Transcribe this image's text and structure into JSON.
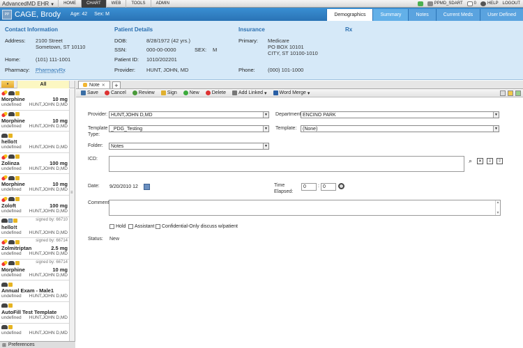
{
  "topbar": {
    "brand": "AdvancedMD EHR",
    "nav": [
      "HOME",
      "CHART",
      "WEB",
      "TOOLS",
      "ADMIN"
    ],
    "active_nav": "CHART",
    "user": "PPMD_SDART",
    "mail_count": "0",
    "help": "HELP",
    "logout": "LOGOUT"
  },
  "patient": {
    "name": "CAGE, Brody",
    "age": "Age: 42",
    "sex": "Sex: M",
    "avatar_text": "PP",
    "tabs": [
      "Demographics",
      "Summary",
      "Notes",
      "Current Meds",
      "User Defined"
    ],
    "active_tab": "Demographics"
  },
  "demographics": {
    "contact": {
      "title": "Contact Information",
      "address_label": "Address:",
      "address_line1": "2100 Street",
      "address_line2": "Sometown, ST 10110",
      "home_label": "Home:",
      "home": "(101) 111-1001",
      "pharmacy_label": "Pharmacy:",
      "pharmacy": "PharmacyRx"
    },
    "details": {
      "title": "Patient Details",
      "dob_label": "DOB:",
      "dob": "8/28/1972 (42 yrs.)",
      "ssn_label": "SSN:",
      "ssn": "000-00-0000",
      "sex_label": "SEX:",
      "sex": "M",
      "pid_label": "Patient ID:",
      "pid": "1010/202201",
      "provider_label": "Provider:",
      "provider": "HUNT, JOHN, MD"
    },
    "insurance": {
      "title": "Insurance",
      "primary_label": "Primary:",
      "primary_line1": "Medicare",
      "primary_line2": "PO BOX 10101",
      "primary_line3": "CITY, ST 10100-1010",
      "phone_label": "Phone:",
      "phone": "(000) 101-1000"
    },
    "rx": {
      "title": "Rx"
    }
  },
  "left_panel": {
    "all_label": "All",
    "items": [
      {
        "title": "Morphine",
        "dose": "10 mg",
        "status": "undefined",
        "provider": "HUNT,JOHN D,MD",
        "signed": ""
      },
      {
        "title": "Morphine",
        "dose": "10 mg",
        "status": "undefined",
        "provider": "HUNT,JOHN D,MD",
        "signed": ""
      },
      {
        "title": "hello!t",
        "dose": "",
        "status": "undefined",
        "provider": "HUNT,JOHN D,MD",
        "signed": ""
      },
      {
        "title": "Zolinza",
        "dose": "100 mg",
        "status": "undefined",
        "provider": "HUNT,JOHN D,MD",
        "signed": ""
      },
      {
        "title": "Morphine",
        "dose": "10 mg",
        "status": "undefined",
        "provider": "HUNT,JOHN D,MD",
        "signed": ""
      },
      {
        "title": "Zoloft",
        "dose": "100 mg",
        "status": "undefined",
        "provider": "HUNT,JOHN D,MD",
        "signed": ""
      },
      {
        "title": "hello!t",
        "dose": "",
        "status": "undefined",
        "provider": "HUNT,JOHN D,MD",
        "signed": "signed by: 66710"
      },
      {
        "title": "Zolmitriptan",
        "dose": "2.5 mg",
        "status": "undefined",
        "provider": "HUNT,JOHN D,MD",
        "signed": "signed by: 66714"
      },
      {
        "title": "Morphine",
        "dose": "10 mg",
        "status": "undefined",
        "provider": "HUNT,JOHN D,MD",
        "signed": "signed by: 66714"
      },
      {
        "title": "Annual Exam - Male1",
        "dose": "",
        "status": "undefined",
        "provider": "HUNT,JOHN D,MD",
        "signed": ""
      },
      {
        "title": "AutoFill Test Template",
        "dose": "",
        "status": "undefined",
        "provider": "HUNT,JOHN D,MD",
        "signed": ""
      },
      {
        "title": "",
        "dose": "",
        "status": "undefined",
        "provider": "HUNT,JOHN D,MD",
        "signed": ""
      }
    ],
    "footer": "Preferences"
  },
  "note": {
    "tab_label": "Note",
    "toolbar": {
      "save": "Save",
      "cancel": "Cancel",
      "review": "Review",
      "sign": "Sign",
      "new": "New",
      "delete": "Delete",
      "add_linked": "Add Linked",
      "word_merge": "Word Merge"
    },
    "form": {
      "provider_label": "Provider:",
      "provider": "HUNT,JOHN D,MD",
      "department_label": "Department:",
      "department": "ENCINO PARK",
      "template_type_label": "Template Type:",
      "template_type": "_PDG_Testing",
      "template_label": "Template:",
      "template": "(None)",
      "folder_label": "Folder:",
      "folder": "Notes",
      "icd_label": "ICD:",
      "date_label": "Date:",
      "date": "9/20/2010 12",
      "time_elapsed_label": "Time Elapsed:",
      "hours": "0",
      "minutes": "0",
      "comment_label": "Comment:",
      "hold": "Hold",
      "assistant": "Assistant",
      "confidential": "Confidential-Only discuss w/patient",
      "status_label": "Status:",
      "status": "New"
    }
  }
}
